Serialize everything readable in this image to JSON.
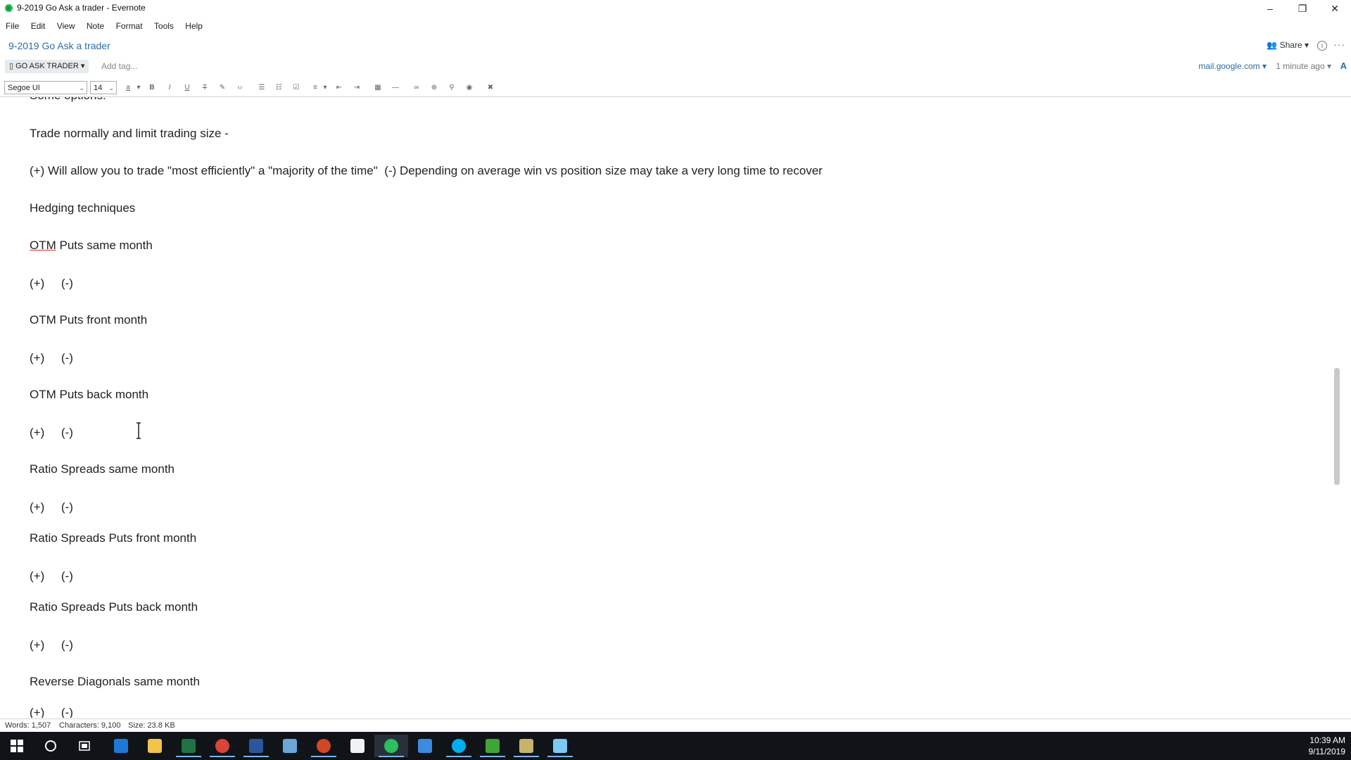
{
  "window": {
    "title": "9-2019 Go Ask a trader - Evernote",
    "minimize": "–",
    "maximize": "❐",
    "close": "✕"
  },
  "menu": [
    "File",
    "Edit",
    "View",
    "Note",
    "Format",
    "Tools",
    "Help"
  ],
  "note": {
    "title": "9-2019 Go Ask a trader",
    "share_label": "Share",
    "notebook": "GO ASK TRADER",
    "add_tag_placeholder": "Add tag...",
    "source": "mail.google.com",
    "updated": "1 minute ago"
  },
  "toolbar": {
    "font": "Segoe UI",
    "size": "14"
  },
  "content": {
    "top_clipped": "Some options:",
    "lines": [
      "Trade normally and limit trading size -",
      "(+) Will allow you to trade \"most efficiently\" a \"majority of the time\"  (-) Depending on average win vs position size may take a very long time to recover",
      "Hedging techniques",
      "OTM",
      " Puts same month",
      "(+)     (-)",
      "OTM Puts front month",
      "(+)     (-)",
      "OTM Puts back month",
      "(+)     (-)",
      "Ratio Spreads same month",
      "(+)     (-)",
      "Ratio Spreads Puts front month",
      "(+)     (-)",
      "Ratio Spreads Puts back month",
      "(+)     (-)",
      "Reverse Diagonals same month",
      "(+)     (-)"
    ]
  },
  "status": {
    "words": "Words: 1,507",
    "characters": "Characters: 9,100",
    "size": "Size: 23.8 KB"
  },
  "taskbar": {
    "time": "10:39 AM",
    "date": "9/11/2019",
    "apps": [
      "start-icon",
      "search-icon",
      "task-view-icon",
      "edge-icon",
      "file-explorer-icon",
      "excel-icon",
      "chrome-icon",
      "word-icon",
      "notepad-icon",
      "powerpoint-icon",
      "store-icon",
      "evernote-icon",
      "todo-icon",
      "skype-icon",
      "thinkorswim-icon",
      "app-icon",
      "snowflake-icon"
    ]
  },
  "colors": {
    "accent": "#2e6da4",
    "taskbar": "#101418",
    "evernote_green": "#2dbe60"
  }
}
